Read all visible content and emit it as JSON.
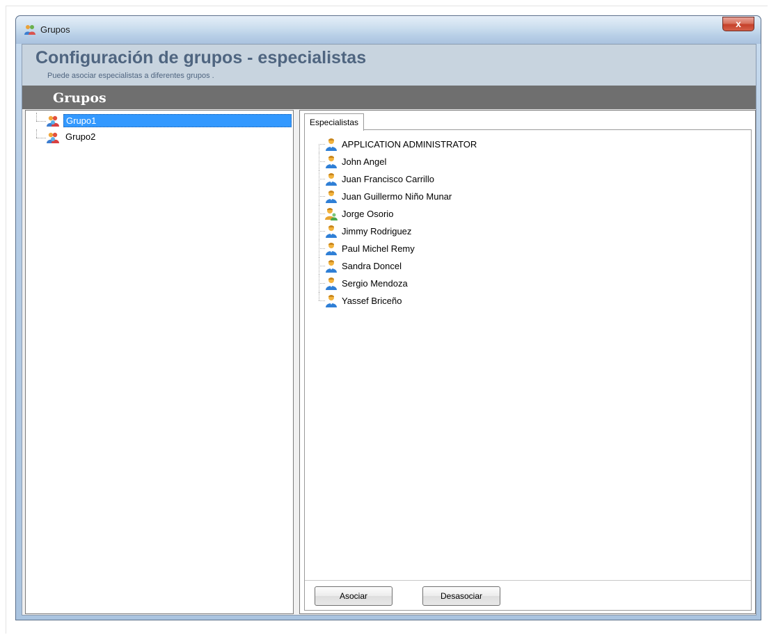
{
  "window": {
    "title": "Grupos",
    "close_label": "x"
  },
  "header": {
    "title": "Configuración de grupos - especialistas",
    "subtitle": "Puede asociar especialistas a diferentes grupos ."
  },
  "section": {
    "title": "Grupos"
  },
  "groups_tree": {
    "items": [
      {
        "label": "Grupo1",
        "selected": true
      },
      {
        "label": "Grupo2",
        "selected": false
      }
    ]
  },
  "specialists_tab": {
    "tab_label": "Especialistas",
    "items": [
      {
        "label": "APPLICATION ADMINISTRATOR",
        "icon": "user-icon"
      },
      {
        "label": "John Angel",
        "icon": "user-icon"
      },
      {
        "label": "Juan Francisco Carrillo",
        "icon": "user-icon"
      },
      {
        "label": "Juan Guillermo Niño Munar",
        "icon": "user-icon"
      },
      {
        "label": "Jorge Osorio",
        "icon": "user-group-icon"
      },
      {
        "label": "Jimmy Rodriguez",
        "icon": "user-icon"
      },
      {
        "label": "Paul Michel Remy",
        "icon": "user-icon"
      },
      {
        "label": "Sandra Doncel",
        "icon": "user-icon"
      },
      {
        "label": "Sergio Mendoza",
        "icon": "user-icon"
      },
      {
        "label": "Yassef Briceño",
        "icon": "user-icon"
      }
    ]
  },
  "actions": {
    "associate_label": "Asociar",
    "dissociate_label": "Desasociar"
  },
  "colors": {
    "header_text": "#4f6580",
    "section_band": "#6f6f6f",
    "selection": "#3399ff",
    "close_button": "#c5402a"
  }
}
